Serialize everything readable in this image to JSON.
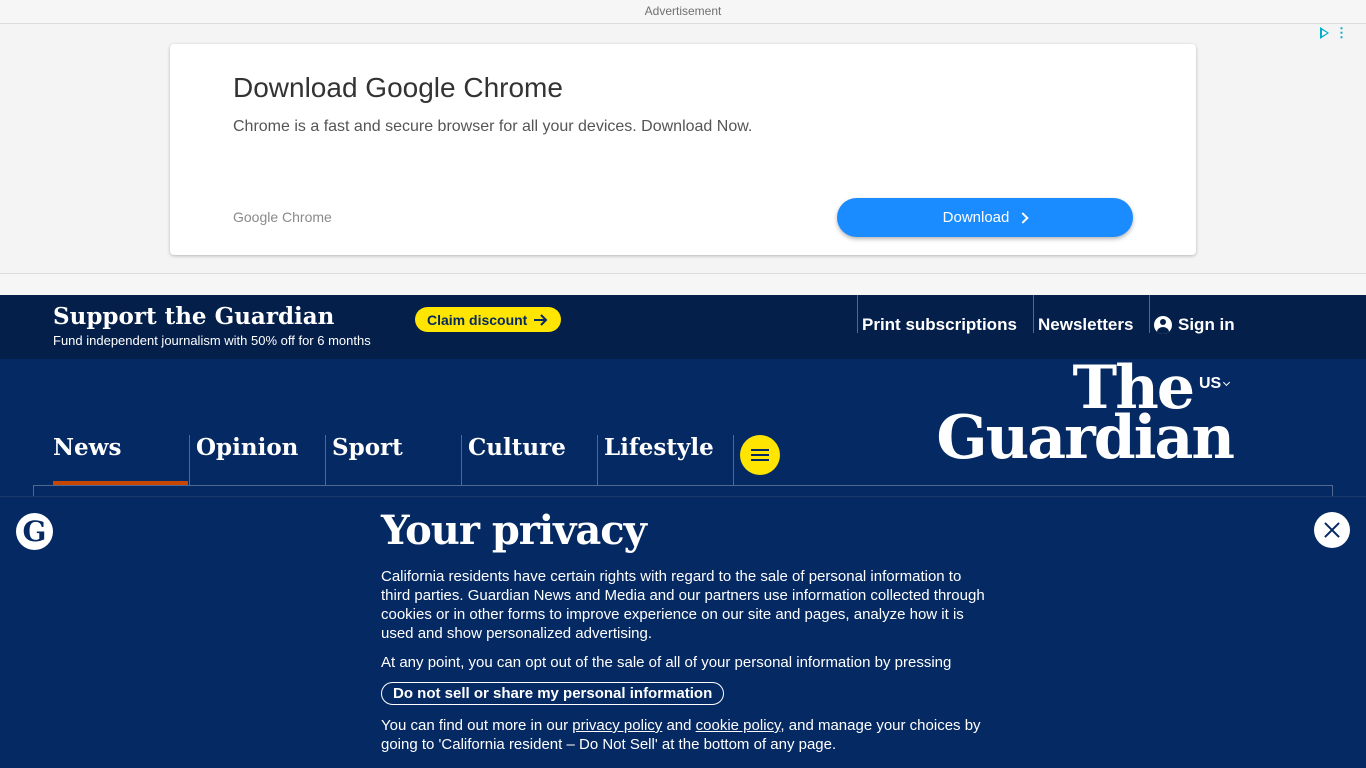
{
  "ad": {
    "label": "Advertisement",
    "title": "Download Google Chrome",
    "description": "Chrome is a fast and secure browser for all your devices. Download Now.",
    "brand": "Google Chrome",
    "button_label": "Download"
  },
  "support": {
    "title": "Support the Guardian",
    "subtitle": "Fund independent journalism with 50% off for 6 months",
    "claim_label": "Claim discount",
    "links": {
      "print": "Print subscriptions",
      "newsletters": "Newsletters",
      "signin": "Sign in"
    }
  },
  "header": {
    "edition": "US",
    "logo_line1": "The",
    "logo_line2": "Guardian",
    "nav": [
      "News",
      "Opinion",
      "Sport",
      "Culture",
      "Lifestyle"
    ],
    "active_nav": "News",
    "accent_color": "#c74600"
  },
  "privacy": {
    "title": "Your privacy",
    "p1": "California residents have certain rights with regard to the sale of personal information to third parties. Guardian News and Media and our partners use information collected through cookies or in other forms to improve experience on our site and pages, analyze how it is used and show personalized advertising.",
    "p2": "At any point, you can opt out of the sale of all of your personal information by pressing",
    "dns_button": "Do not sell or share my personal information",
    "p3_a": "You can find out more in our ",
    "privacy_link": "privacy policy",
    "p3_b": " and ",
    "cookie_link": "cookie policy",
    "p3_c": ", and manage your choices by going to 'California resident – Do Not Sell' at the bottom of any page.",
    "roundel": "G"
  },
  "colors": {
    "guardian_blue": "#052962",
    "support_blue": "#041f4a",
    "yellow": "#ffe500",
    "ad_button": "#1a8cff"
  }
}
